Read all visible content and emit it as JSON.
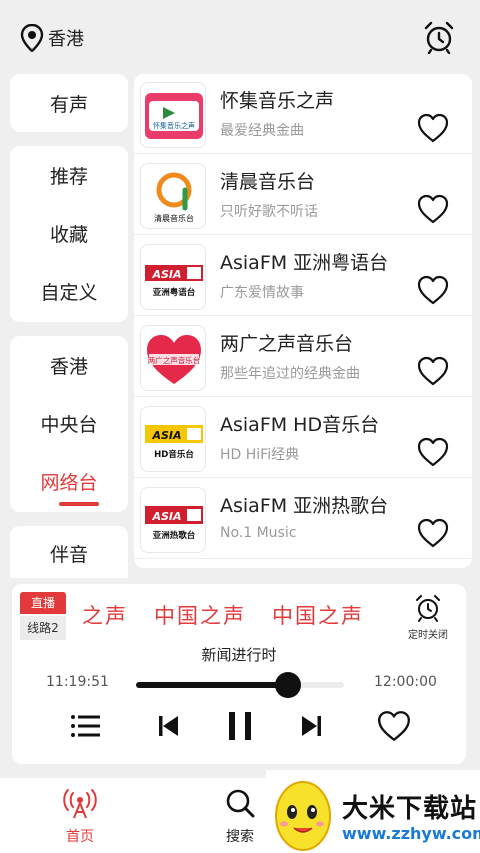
{
  "header": {
    "location": "香港",
    "icon_location": "location-pin-icon",
    "icon_alarm": "alarm-clock-icon"
  },
  "categories": {
    "group1": [
      "有声"
    ],
    "group2": [
      "推荐",
      "收藏",
      "自定义"
    ],
    "group3": [
      "香港",
      "中央台",
      "网络台"
    ],
    "group4": [
      "伴音"
    ],
    "active": "网络台"
  },
  "stations": [
    {
      "name": "怀集音乐之声",
      "desc": "最爱经典金曲",
      "logo_text": "怀集音乐之声"
    },
    {
      "name": "清晨音乐台",
      "desc": "只听好歌不听话",
      "logo_text": "清晨音乐台"
    },
    {
      "name": "AsiaFM 亚洲粤语台",
      "desc": "广东爱情故事",
      "logo_text": "亚洲粤语台",
      "logo_brand": "ASIA"
    },
    {
      "name": "两广之声音乐台",
      "desc": "那些年追过的经典金曲",
      "logo_text": "两广之声音乐台"
    },
    {
      "name": "AsiaFM HD音乐台",
      "desc": "HD HiFi经典",
      "logo_text": "HD音乐台",
      "logo_brand": "ASIA"
    },
    {
      "name": "AsiaFM 亚洲热歌台",
      "desc": "No.1 Music",
      "logo_text": "亚洲热歌台",
      "logo_brand": "ASIA"
    }
  ],
  "player": {
    "live_label": "直播",
    "line_label": "线路2",
    "marquee": [
      "之声",
      "中国之声",
      "中国之声"
    ],
    "timer_label": "定时关闭",
    "program": "新闻进行时",
    "time_start": "11:19:51",
    "time_end": "12:00:00",
    "progress": 0.73
  },
  "nav": {
    "home": "首页",
    "search": "搜索"
  },
  "watermark": {
    "name": "大米下载站",
    "url": "www.zzhyw.com"
  },
  "colors": {
    "accent": "#e23a3a",
    "asia_red": "#d11f2f",
    "asia_yellow": "#f6c700"
  }
}
